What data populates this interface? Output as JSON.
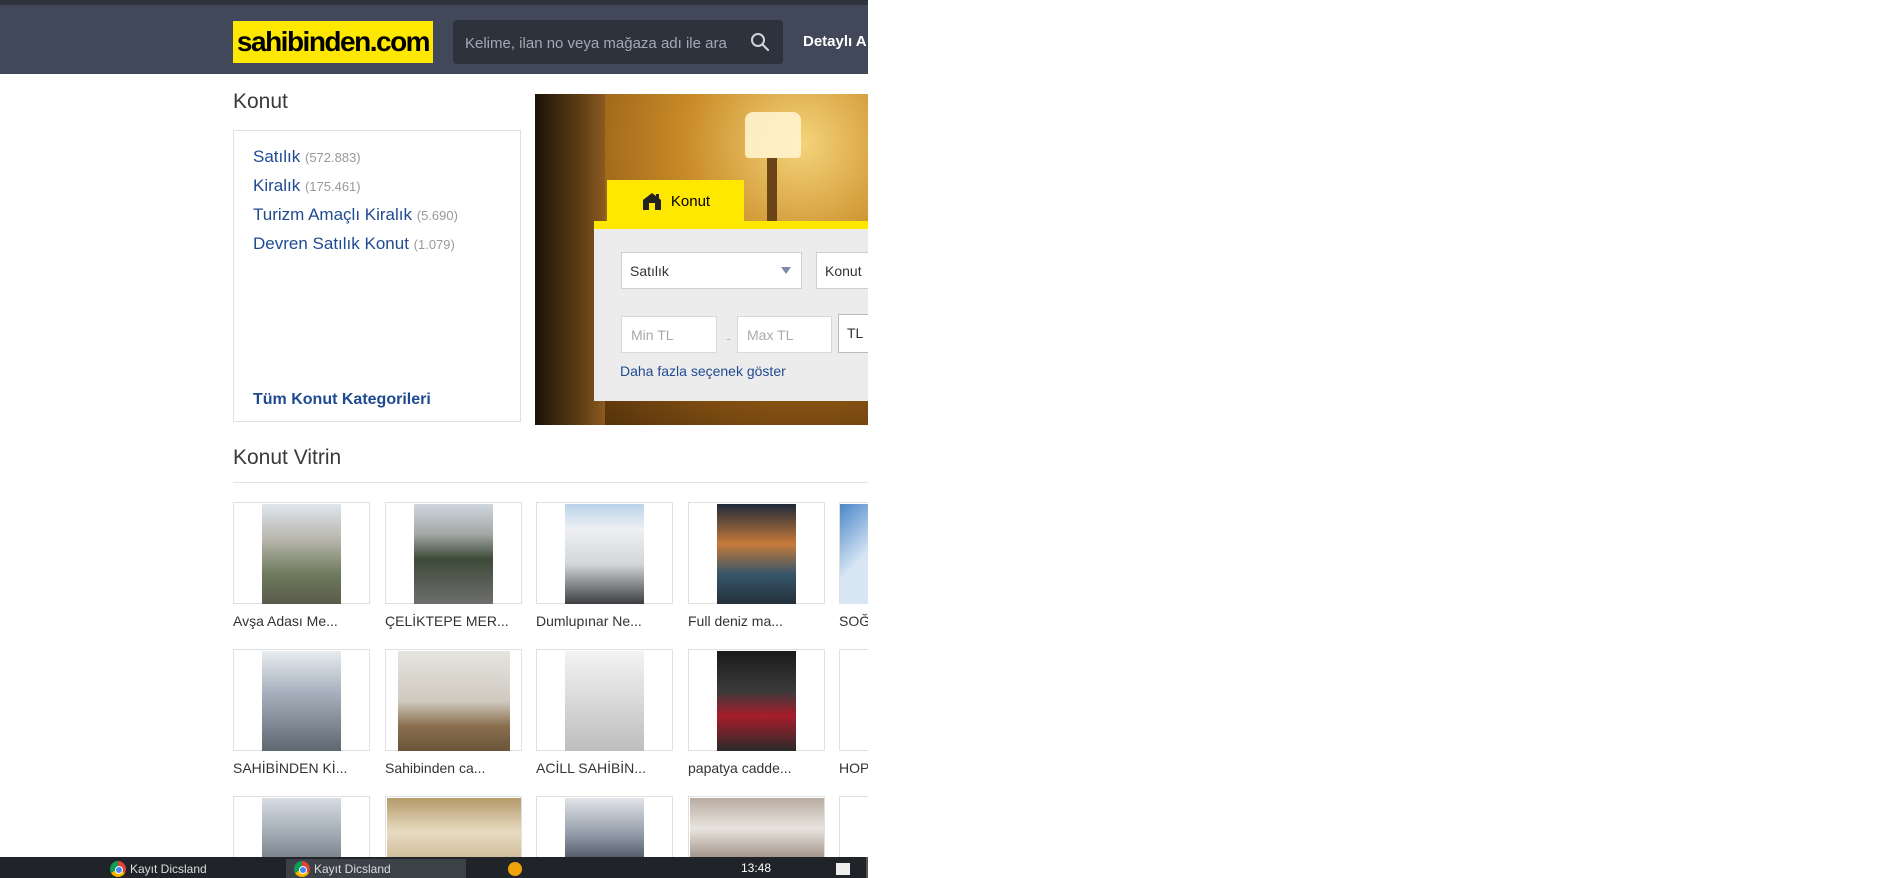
{
  "header": {
    "logo": "sahibinden.com",
    "search_placeholder": "Kelime, ilan no veya mağaza adı ile ara",
    "detayli": "Detaylı A"
  },
  "konut": {
    "title": "Konut",
    "categories": [
      {
        "label": "Satılık",
        "count": "(572.883)"
      },
      {
        "label": "Kiralık",
        "count": "(175.461)"
      },
      {
        "label": "Turizm Amaçlı Kiralık",
        "count": "(5.690)"
      },
      {
        "label": "Devren Satılık Konut",
        "count": "(1.079)"
      }
    ],
    "all_categories": "Tüm Konut Kategorileri"
  },
  "search_panel": {
    "tab": "Konut",
    "type_select": "Satılık",
    "category_select": "Konut",
    "min_placeholder": "Min TL",
    "max_placeholder": "Max TL",
    "dash": "-",
    "currency": "TL",
    "more_options": "Daha fazla seçenek göster"
  },
  "vitrin": {
    "title": "Konut Vitrin",
    "row1": [
      "Avşa Adası Me...",
      "ÇELİKTEPE MER...",
      "Dumlupınar Ne...",
      "Full deniz ma...",
      "SOĞ"
    ],
    "row2": [
      "SAHİBİNDEN Kİ...",
      "Sahibinden ca...",
      "ACİLL SAHİBİN...",
      "papatya cadde...",
      "HOP."
    ]
  },
  "taskbar": {
    "clock": "13:48",
    "items": [
      "Kayıt Dicsland",
      "Kayıt Dicsland"
    ]
  },
  "colors": {
    "header_bg": "#404859",
    "logo_bg": "#ffe800",
    "link": "#1f4a91"
  }
}
